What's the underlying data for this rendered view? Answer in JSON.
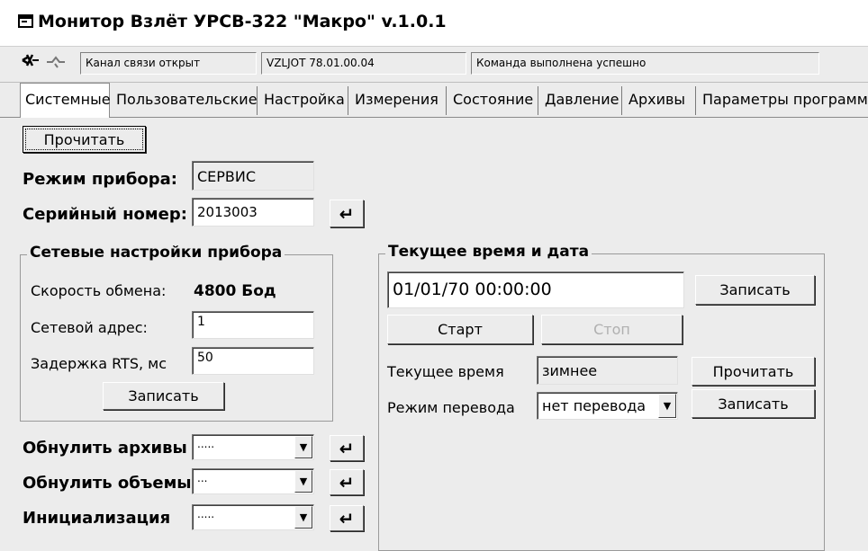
{
  "window": {
    "title": "Монитор Взлёт УРСВ-322 \"Макро\" v.1.0.1",
    "app_icon": "window-icon"
  },
  "toolbar": {
    "connect_icon": "plug-disconnect-icon",
    "link_icon": "link-icon",
    "status_channel": "Канал связи открыт",
    "status_version": "VZLJOT 78.01.00.04",
    "status_command": "Команда выполнена успешно"
  },
  "tabs": [
    {
      "label": "Системные",
      "active": true
    },
    {
      "label": "Пользовательские"
    },
    {
      "label": "Настройка"
    },
    {
      "label": "Измерения"
    },
    {
      "label": "Состояние"
    },
    {
      "label": "Давление"
    },
    {
      "label": "Архивы"
    },
    {
      "label": "Параметры программы"
    }
  ],
  "system": {
    "read_button": "Прочитать",
    "mode_label": "Режим прибора:",
    "mode_value": "СЕРВИС",
    "serial_label": "Серийный номер:",
    "serial_value": "2013003",
    "enter_glyph": "↵"
  },
  "network": {
    "title": "Сетевые настройки прибора",
    "speed_label": "Скорость обмена:",
    "speed_value": "4800 Бод",
    "address_label": "Сетевой адрес:",
    "address_value": "1",
    "rts_label": "Задержка RTS, мс",
    "rts_value": "50",
    "write_button": "Записать"
  },
  "resets": [
    {
      "label": "Обнулить архивы",
      "value": "....."
    },
    {
      "label": "Обнулить объемы",
      "value": "..."
    },
    {
      "label": "Инициализация",
      "value": "....."
    }
  ],
  "time": {
    "title": "Текущее время и дата",
    "datetime_value": "01/01/70 00:00:00",
    "write_button": "Записать",
    "start_button": "Старт",
    "stop_button": "Стоп",
    "current_label": "Текущее время",
    "current_value": "зимнее",
    "read_button": "Прочитать",
    "switch_label": "Режим перевода",
    "switch_value": "нет перевода",
    "write_button2": "Записать"
  }
}
